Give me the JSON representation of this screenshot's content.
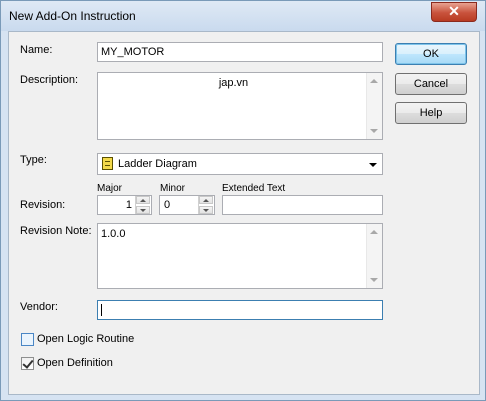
{
  "window": {
    "title": "New Add-On Instruction",
    "close_glyph": "✕"
  },
  "fields": {
    "name": {
      "label": "Name:",
      "value": "MY_MOTOR"
    },
    "description": {
      "label": "Description:",
      "value": "jap.vn"
    },
    "type": {
      "label": "Type:",
      "value": "Ladder Diagram"
    },
    "revision": {
      "label": "Revision:",
      "major_label": "Major",
      "major_value": "1",
      "minor_label": "Minor",
      "minor_value": "0",
      "extended_label": "Extended Text",
      "extended_value": ""
    },
    "revision_note": {
      "label": "Revision Note:",
      "value": "1.0.0"
    },
    "vendor": {
      "label": "Vendor:",
      "value": ""
    }
  },
  "checkboxes": {
    "open_logic_routine": {
      "label": "Open Logic Routine",
      "checked": false
    },
    "open_definition": {
      "label": "Open Definition",
      "checked": true
    }
  },
  "buttons": {
    "ok": "OK",
    "cancel": "Cancel",
    "help": "Help"
  },
  "colors": {
    "frame": "#d6e3f2",
    "client": "#f0f0f0",
    "close": "#c8523c",
    "default_button": "#3c7fb1"
  }
}
